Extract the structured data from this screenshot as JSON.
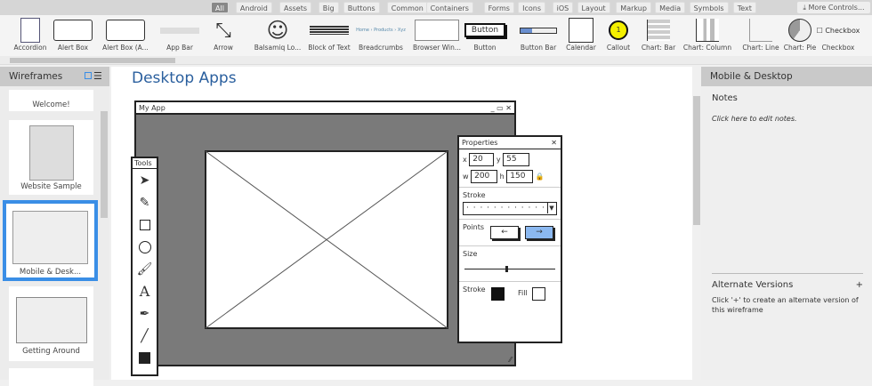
{
  "tabs": [
    "All",
    "Android",
    "Assets",
    "Big",
    "Buttons",
    "Common",
    "Containers",
    "Forms",
    "Icons",
    "iOS",
    "Layout",
    "Markup",
    "Media",
    "Symbols",
    "Text"
  ],
  "more_controls": "More Controls...",
  "palette": [
    "Accordion",
    "Alert Box",
    "Alert Box (A...",
    "App Bar",
    "Arrow",
    "Balsamiq Lo...",
    "Block of Text",
    "Breadcrumbs",
    "Browser Win...",
    "Button",
    "Button Bar",
    "Calendar",
    "Callout",
    "Chart: Bar",
    "Chart: Column",
    "Chart: Line",
    "Chart: Pie",
    "Checkbox"
  ],
  "palette_button_text": "Button",
  "palette_checkbox_text": "Checkbox",
  "palette_callout_text": "1",
  "left": {
    "title": "Wireframes",
    "items": [
      "Welcome!",
      "Website Sample",
      "Mobile & Desk...",
      "Getting Around"
    ]
  },
  "canvas": {
    "title": "Desktop Apps",
    "window_title": "My App",
    "tools_title": "Tools",
    "props": {
      "title": "Properties",
      "x_label": "x",
      "x": "20",
      "y_label": "y",
      "y": "55",
      "w_label": "w",
      "w": "200",
      "h_label": "h",
      "h": "150",
      "stroke": "Stroke",
      "points": "Points",
      "size": "Size",
      "stroke2": "Stroke",
      "fill": "Fill",
      "size_value": 0.45
    }
  },
  "right": {
    "title": "Mobile & Desktop",
    "notes": "Notes",
    "notes_hint": "Click here to edit notes.",
    "alt": "Alternate Versions",
    "alt_plus": "+",
    "alt_hint": "Click '+' to create an alternate version of this wireframe"
  },
  "colors": {
    "selection": "#3a8ee6",
    "heading": "#2a5f9e",
    "points_active": "#8bb8f0",
    "callout": "#f4f000"
  }
}
